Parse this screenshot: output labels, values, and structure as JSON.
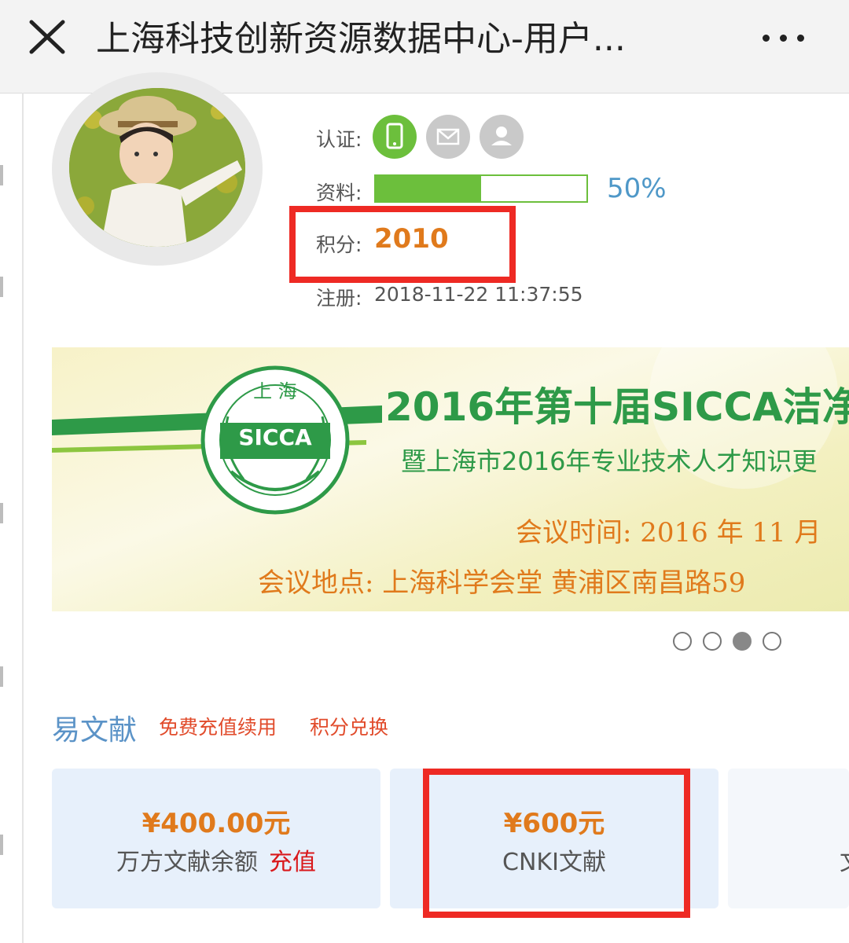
{
  "header": {
    "title": "上海科技创新资源数据中心-用户..."
  },
  "profile": {
    "cert_label": "认证:",
    "cert_icons": [
      "phone-icon",
      "mail-icon",
      "user-icon"
    ],
    "data_label": "资料:",
    "completeness_percent": 50,
    "completeness_text": "50%",
    "points_label": "积分:",
    "points_value": "2010",
    "register_label": "注册:",
    "register_value": "2018-11-22 11:37:55"
  },
  "banner": {
    "logo_top": "上 海",
    "logo_text": "SICCA",
    "title": "2016年第十届SICCA洁净",
    "subtitle": "暨上海市2016年专业技术人才知识更",
    "time": "会议时间: 2016 年 11 月",
    "location": "会议地点: 上海科学会堂 黄浦区南昌路59"
  },
  "carousel": {
    "count": 4,
    "active_index": 2
  },
  "section": {
    "title": "易文献",
    "link_free": "免费充值续用",
    "link_exchange": "积分兑换"
  },
  "cards": [
    {
      "amount": "¥400.00元",
      "label": "万方文献余额",
      "action": "充值"
    },
    {
      "amount": "¥600元",
      "label": "CNKI文献"
    },
    {
      "amount": "",
      "label": "文"
    }
  ],
  "colors": {
    "accent_green": "#6cbf3c",
    "accent_orange": "#e07a1c",
    "highlight_red": "#ee2a24",
    "link_blue": "#5b93c7"
  }
}
